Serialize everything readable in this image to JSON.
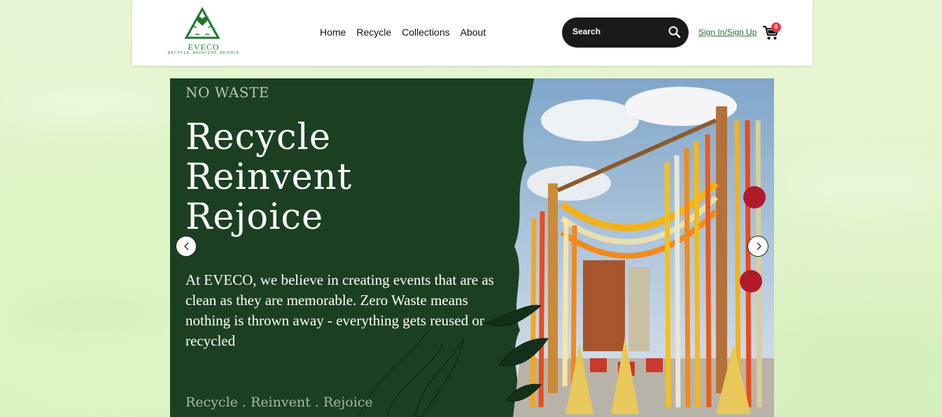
{
  "brand": {
    "name": "EVECO",
    "tagline": "RECYCLE. REINVENT. REJOICE",
    "accent": "#1b7a2c"
  },
  "nav": {
    "items": [
      "Home",
      "Recycle",
      "Collections",
      "About"
    ]
  },
  "search": {
    "label": "Search",
    "icon": "search-icon"
  },
  "account": {
    "signin_label": "Sign In/Sign Up",
    "cart_count": "0"
  },
  "hero": {
    "eyebrow": "NO WASTE",
    "title_lines": [
      "Recycle",
      "Reinvent",
      "Rejoice"
    ],
    "body": "At EVECO, we believe in  creating events that are as clean as they are memorable. Zero Waste means nothing is thrown away - everything gets reused or recycled",
    "footer": "Recycle . Reinvent . Rejoice",
    "background": "#1c3f22"
  },
  "carousel": {
    "prev_icon": "chevron-left-icon",
    "next_icon": "chevron-right-icon"
  }
}
